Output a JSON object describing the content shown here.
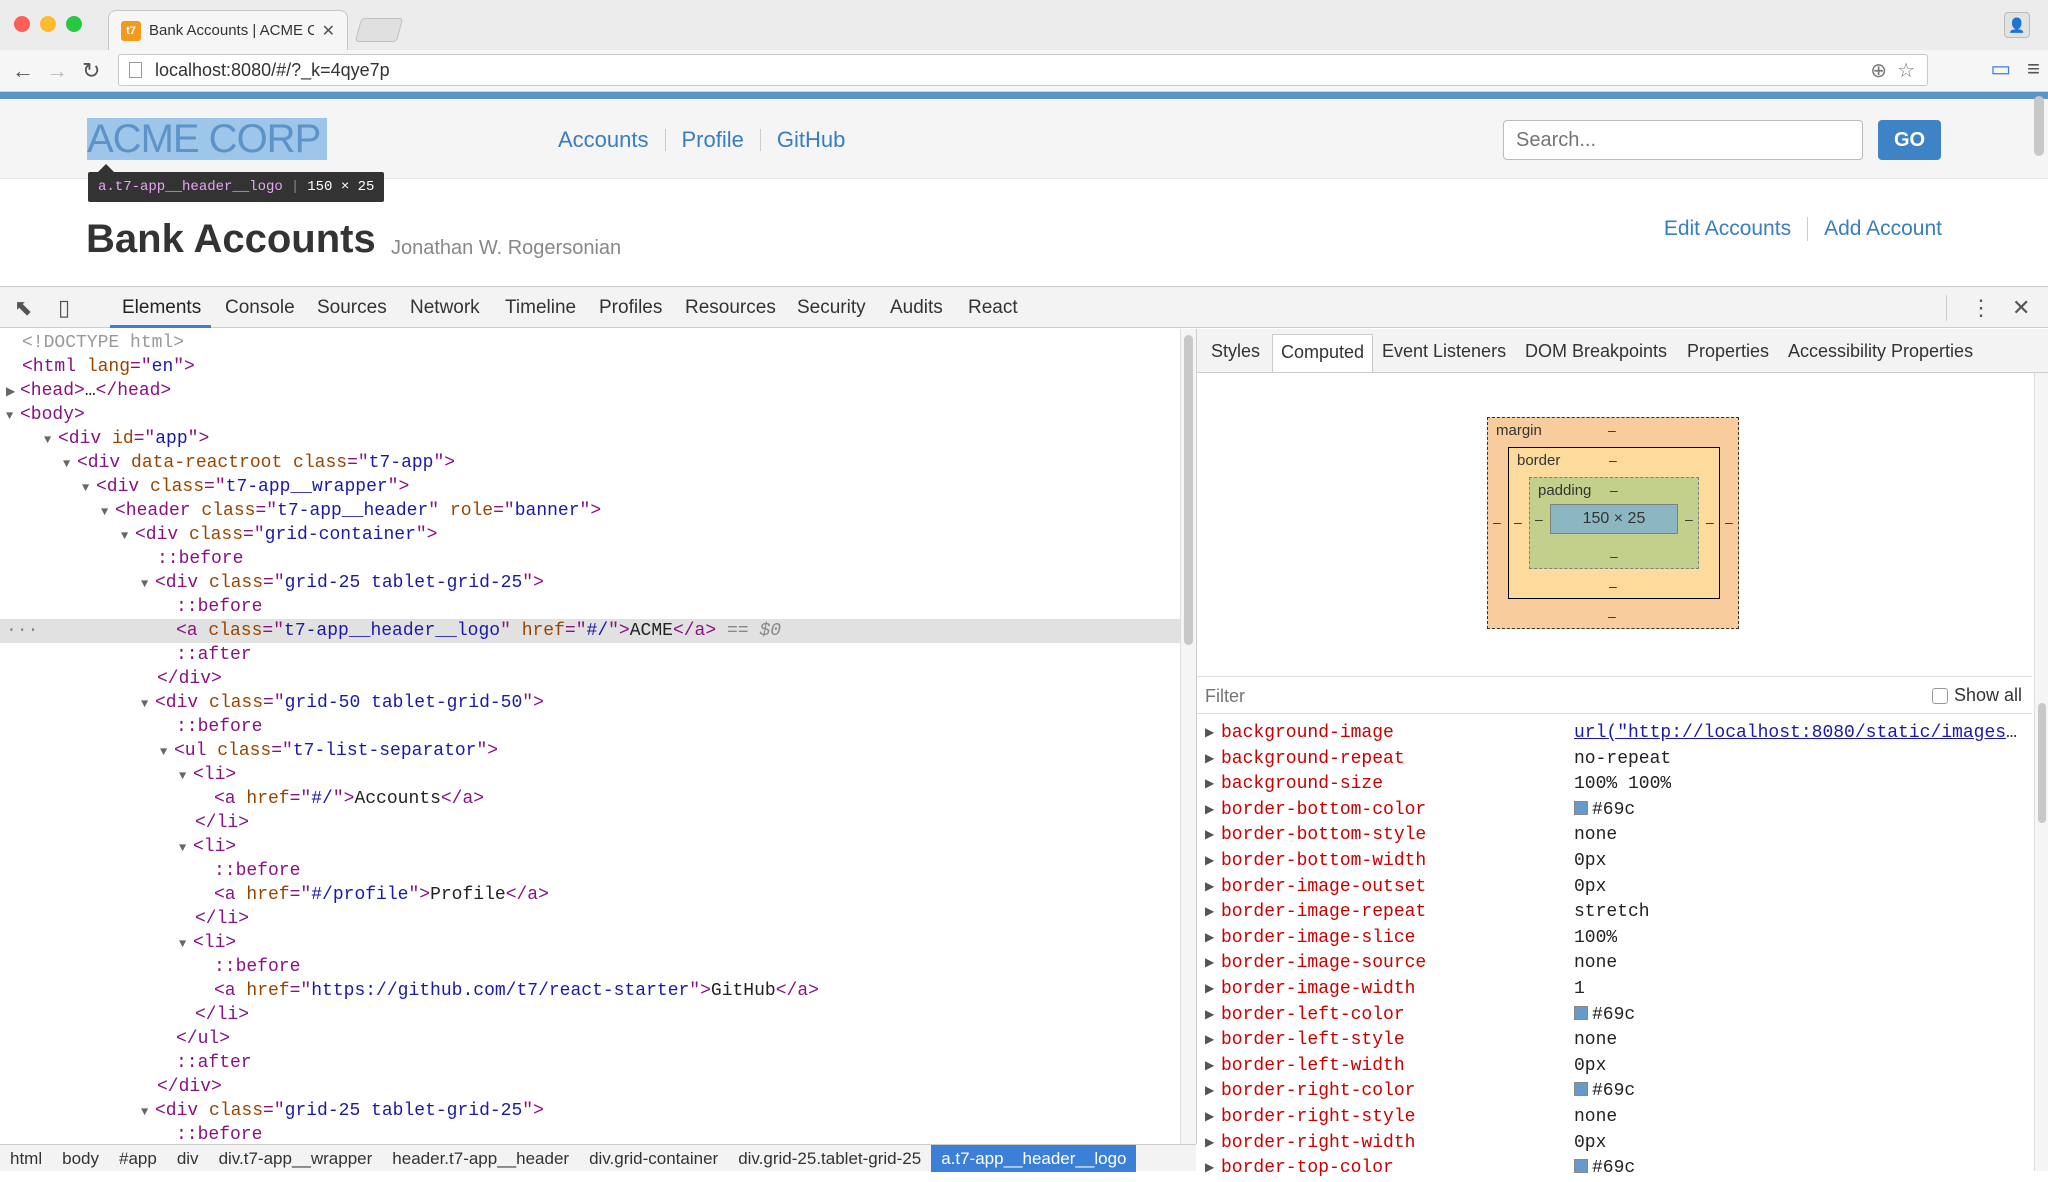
{
  "browser": {
    "tab_title": "Bank Accounts | ACME Cor",
    "tab_favicon": "t7",
    "url": "localhost:8080/#/?_k=4qye7p"
  },
  "app": {
    "logo": "ACME CORP",
    "tooltip_selector": "a.t7-app__header__logo",
    "tooltip_size": "150 × 25",
    "nav": [
      "Accounts",
      "Profile",
      "GitHub"
    ],
    "search_placeholder": "Search...",
    "go_label": "GO",
    "page_title": "Bank Accounts",
    "page_subtitle": "Jonathan W. Rogersonian",
    "actions": [
      "Edit Accounts",
      "Add Account"
    ]
  },
  "devtools": {
    "tabs": [
      "Elements",
      "Console",
      "Sources",
      "Network",
      "Timeline",
      "Profiles",
      "Resources",
      "Security",
      "Audits",
      "React"
    ],
    "breadcrumbs": [
      "html",
      "body",
      "#app",
      "div",
      "div.t7-app__wrapper",
      "header.t7-app__header",
      "div.grid-container",
      "div.grid-25.tablet-grid-25",
      "a.t7-app__header__logo"
    ],
    "side_tabs": [
      "Styles",
      "Computed",
      "Event Listeners",
      "DOM Breakpoints",
      "Properties",
      "Accessibility Properties"
    ],
    "boxmodel": {
      "margin": "margin",
      "border": "border",
      "padding": "padding",
      "content": "150 × 25",
      "dash": "–"
    },
    "filter_placeholder": "Filter",
    "show_all": "Show all",
    "selected_marker": "== $0",
    "computed": [
      {
        "name": "background-image",
        "value": "url(\"http://localhost:8080/static/images/…"
      },
      {
        "name": "background-repeat",
        "value": "no-repeat"
      },
      {
        "name": "background-size",
        "value": "100% 100%"
      },
      {
        "name": "border-bottom-color",
        "value": "#69c"
      },
      {
        "name": "border-bottom-style",
        "value": "none"
      },
      {
        "name": "border-bottom-width",
        "value": "0px"
      },
      {
        "name": "border-image-outset",
        "value": "0px"
      },
      {
        "name": "border-image-repeat",
        "value": "stretch"
      },
      {
        "name": "border-image-slice",
        "value": "100%"
      },
      {
        "name": "border-image-source",
        "value": "none"
      },
      {
        "name": "border-image-width",
        "value": "1"
      },
      {
        "name": "border-left-color",
        "value": "#69c"
      },
      {
        "name": "border-left-style",
        "value": "none"
      },
      {
        "name": "border-left-width",
        "value": "0px"
      },
      {
        "name": "border-right-color",
        "value": "#69c"
      },
      {
        "name": "border-right-style",
        "value": "none"
      },
      {
        "name": "border-right-width",
        "value": "0px"
      },
      {
        "name": "border-top-color",
        "value": "#69c"
      }
    ]
  }
}
